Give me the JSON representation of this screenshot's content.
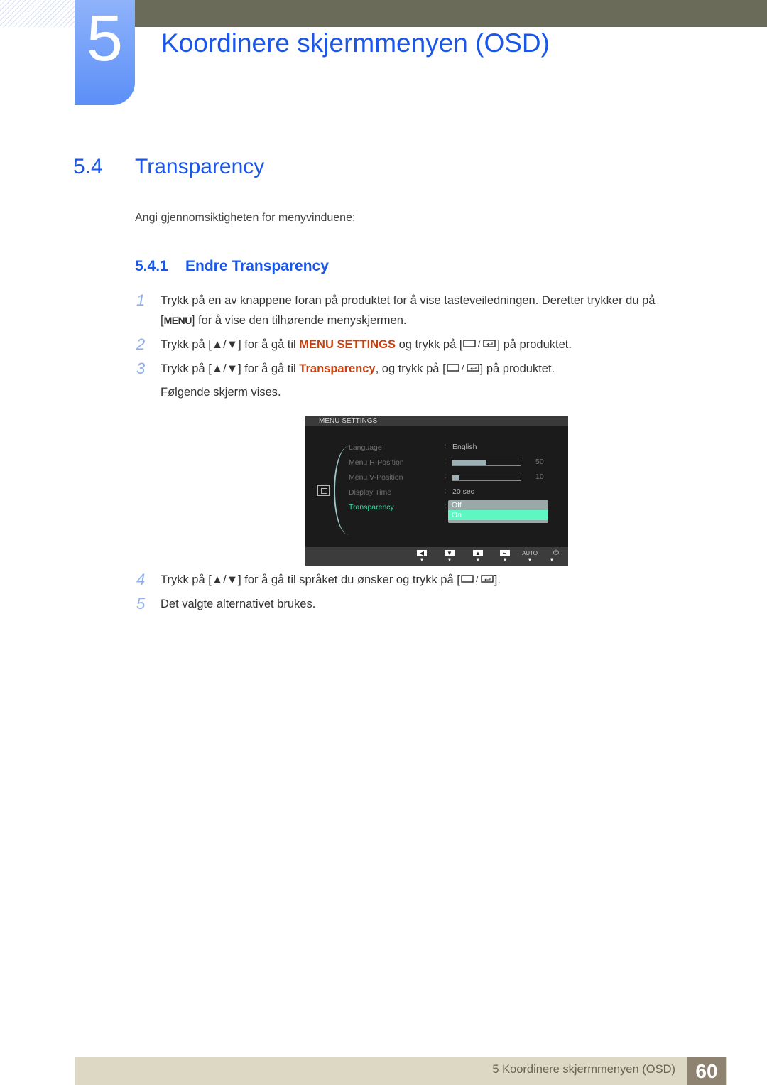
{
  "header": {
    "chapter_number": "5",
    "chapter_title": "Koordinere skjermmenyen (OSD)"
  },
  "section": {
    "number": "5.4",
    "title": "Transparency",
    "intro": "Angi gjennomsiktigheten for menyvinduene:"
  },
  "subsection": {
    "number": "5.4.1",
    "title": "Endre Transparency"
  },
  "steps": [
    {
      "num": "1",
      "line1": "Trykk på en av knappene foran på produktet for å vise tasteveiledningen. Deretter trykker du på",
      "menu_key": "MENU",
      "line2": "for å vise den tilhørende menyskjermen."
    },
    {
      "num": "2",
      "pre": "Trykk på [",
      "arrows": "▲/▼",
      "mid": "] for å gå til",
      "highlight": "MENU SETTINGS",
      "post1": "og trykk på [",
      "post2": "] på produktet."
    },
    {
      "num": "3",
      "pre": "Trykk på [",
      "arrows": "▲/▼",
      "mid": "] for å gå til",
      "highlight": "Transparency",
      "post1": ", og trykk på [",
      "post2": "] på produktet.",
      "line2": "Følgende skjerm vises."
    },
    {
      "num": "4",
      "pre": "Trykk på [",
      "arrows": "▲/▼",
      "mid": "] for å gå til språket du ønsker og trykk på [",
      "post2": "]."
    },
    {
      "num": "5",
      "text": "Det valgte alternativet brukes."
    }
  ],
  "osd": {
    "title": "MENU SETTINGS",
    "items": [
      {
        "label": "Language",
        "value": "English"
      },
      {
        "label": "Menu H-Position",
        "value": "50",
        "level": 0.5
      },
      {
        "label": "Menu V-Position",
        "value": "10",
        "level": 0.1
      },
      {
        "label": "Display Time",
        "value": "20 sec"
      },
      {
        "label": "Transparency",
        "active": true
      }
    ],
    "dropdown": {
      "options": [
        "Off",
        "On"
      ],
      "selected": "On"
    },
    "footer_buttons": [
      "left-arrow",
      "down-arrow",
      "up-arrow",
      "enter",
      "AUTO",
      "power"
    ]
  },
  "footer": {
    "text": "5 Koordinere skjermmenyen (OSD)",
    "page": "60"
  },
  "colors": {
    "accent": "#1a56e8",
    "highlight": "#c8400d",
    "osd_active": "#3fd6a0"
  }
}
